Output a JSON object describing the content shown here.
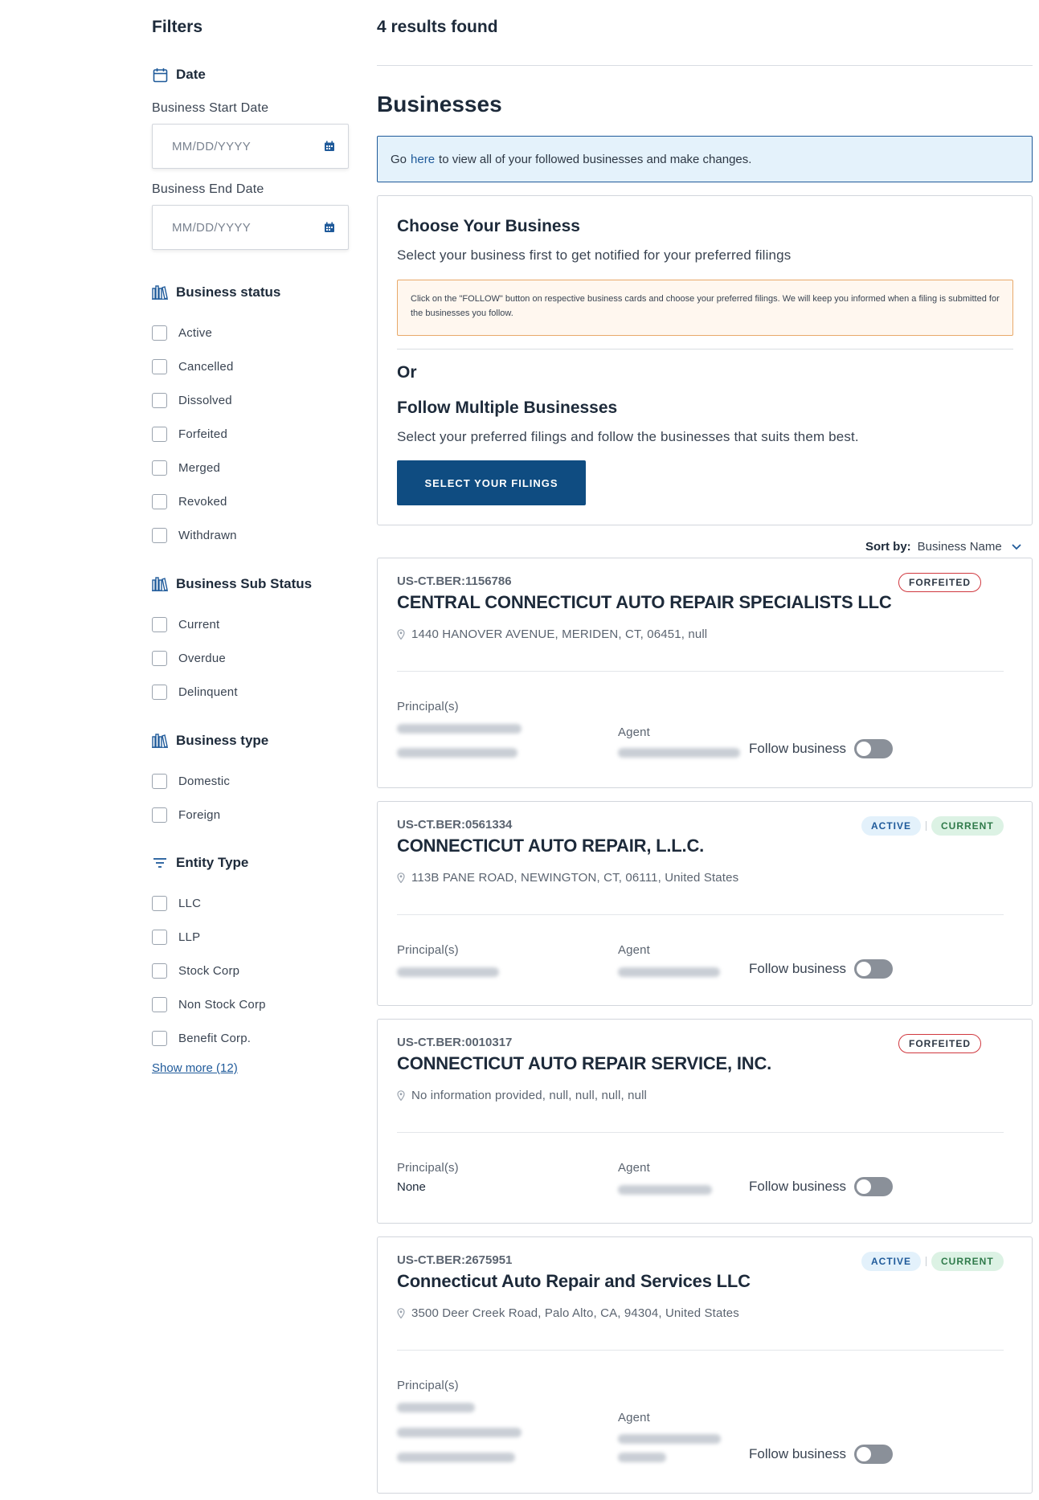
{
  "filters": {
    "title": "Filters",
    "date": {
      "heading": "Date",
      "icon": "calendar-icon",
      "start_label": "Business Start Date",
      "start_placeholder": "MM/DD/YYYY",
      "end_label": "Business End Date",
      "end_placeholder": "MM/DD/YYYY"
    },
    "status": {
      "heading": "Business status",
      "icon": "books-icon",
      "options": [
        "Active",
        "Cancelled",
        "Dissolved",
        "Forfeited",
        "Merged",
        "Revoked",
        "Withdrawn"
      ]
    },
    "sub_status": {
      "heading": "Business Sub Status",
      "icon": "books-icon",
      "options": [
        "Current",
        "Overdue",
        "Delinquent"
      ]
    },
    "type": {
      "heading": "Business type",
      "icon": "books-icon",
      "options": [
        "Domestic",
        "Foreign"
      ]
    },
    "entity": {
      "heading": "Entity Type",
      "icon": "filter-lines-icon",
      "options": [
        "LLC",
        "LLP",
        "Stock Corp",
        "Non Stock Corp",
        "Benefit Corp."
      ]
    },
    "show_more": "Show more (12)"
  },
  "main": {
    "results": "4 results found",
    "title": "Businesses",
    "banner": {
      "prefix": "Go",
      "link": "here",
      "suffix": "to view all of your followed businesses and make changes."
    },
    "choose": {
      "title": "Choose Your Business",
      "subtitle": "Select your business first to get notified for your preferred filings",
      "notice": "Click on the \"FOLLOW\" button on respective business cards and choose your preferred filings. We will keep you informed when a filing is submitted for the businesses you follow.",
      "or": "Or",
      "multi_title": "Follow Multiple Businesses",
      "multi_subtitle": "Select your preferred filings and follow the businesses that suits them best.",
      "button": "SELECT YOUR FILINGS"
    },
    "sort": {
      "label": "Sort by:",
      "value": "Business Name"
    },
    "labels": {
      "principals": "Principal(s)",
      "agent": "Agent",
      "follow": "Follow business"
    },
    "businesses": [
      {
        "id": "US-CT.BER:1156786",
        "name": "CENTRAL CONNECTICUT AUTO REPAIR SPECIALISTS LLC",
        "address": "1440 HANOVER AVENUE, MERIDEN, CT, 06451, null",
        "badges": [
          "FORFEITED"
        ],
        "principal_text": ""
      },
      {
        "id": "US-CT.BER:0561334",
        "name": "CONNECTICUT AUTO REPAIR, L.L.C.",
        "address": "113B PANE ROAD, NEWINGTON, CT, 06111, United States",
        "badges": [
          "ACTIVE",
          "CURRENT"
        ],
        "principal_text": ""
      },
      {
        "id": "US-CT.BER:0010317",
        "name": "CONNECTICUT AUTO REPAIR SERVICE, INC.",
        "address": "No information provided, null, null, null, null",
        "badges": [
          "FORFEITED"
        ],
        "principal_text": "None"
      },
      {
        "id": "US-CT.BER:2675951",
        "name": "Connecticut Auto Repair and Services LLC",
        "address": "3500 Deer Creek Road, Palo Alto, CA, 94304, United States",
        "badges": [
          "ACTIVE",
          "CURRENT"
        ],
        "principal_text": ""
      }
    ]
  },
  "colors": {
    "accent": "#1f5a9a",
    "button": "#0f4c81",
    "forfeited": "#d0383f",
    "active_bg": "#e3f1fb",
    "current_bg": "#dcf2e4"
  }
}
